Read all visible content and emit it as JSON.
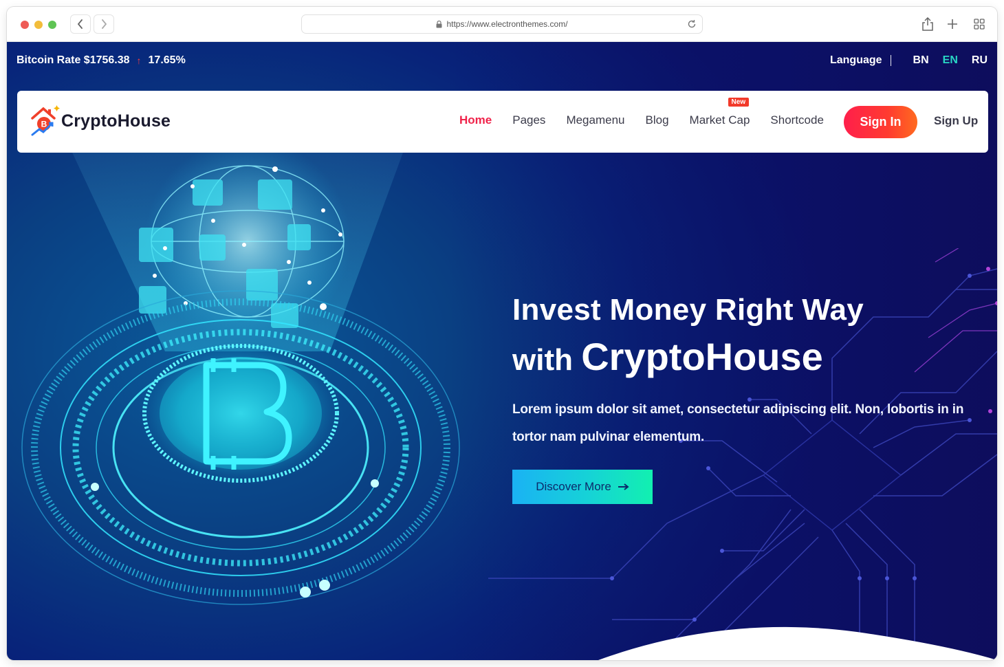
{
  "browser": {
    "url": "https://www.electronthemes.com/"
  },
  "topbar": {
    "rate_label": "Bitcoin Rate $1756.38",
    "change": "17.65%",
    "language_label": "Language",
    "languages": [
      {
        "code": "BN",
        "active": false
      },
      {
        "code": "EN",
        "active": true
      },
      {
        "code": "RU",
        "active": false
      }
    ]
  },
  "header": {
    "logo_text": "CryptoHouse",
    "nav": [
      {
        "label": "Home",
        "active": true
      },
      {
        "label": "Pages",
        "active": false
      },
      {
        "label": "Megamenu",
        "active": false
      },
      {
        "label": "Blog",
        "active": false
      },
      {
        "label": "Market Cap",
        "active": false,
        "badge": "New"
      },
      {
        "label": "Shortcode",
        "active": false
      }
    ],
    "signin_label": "Sign In",
    "signup_label": "Sign Up"
  },
  "hero": {
    "title_line1": "Invest Money Right Way",
    "title_line2_prefix": "with",
    "title_line2_brand": "CryptoHouse",
    "description": "Lorem ipsum dolor sit amet, consectetur adipiscing elit. Non, lobortis in in tortor nam pulvinar elementum.",
    "cta_label": "Discover More"
  },
  "colors": {
    "accent_red": "#f0234a",
    "accent_cyan": "#16d3d6",
    "bg_navy": "#0a136b",
    "active_lang": "#29d6c4"
  }
}
